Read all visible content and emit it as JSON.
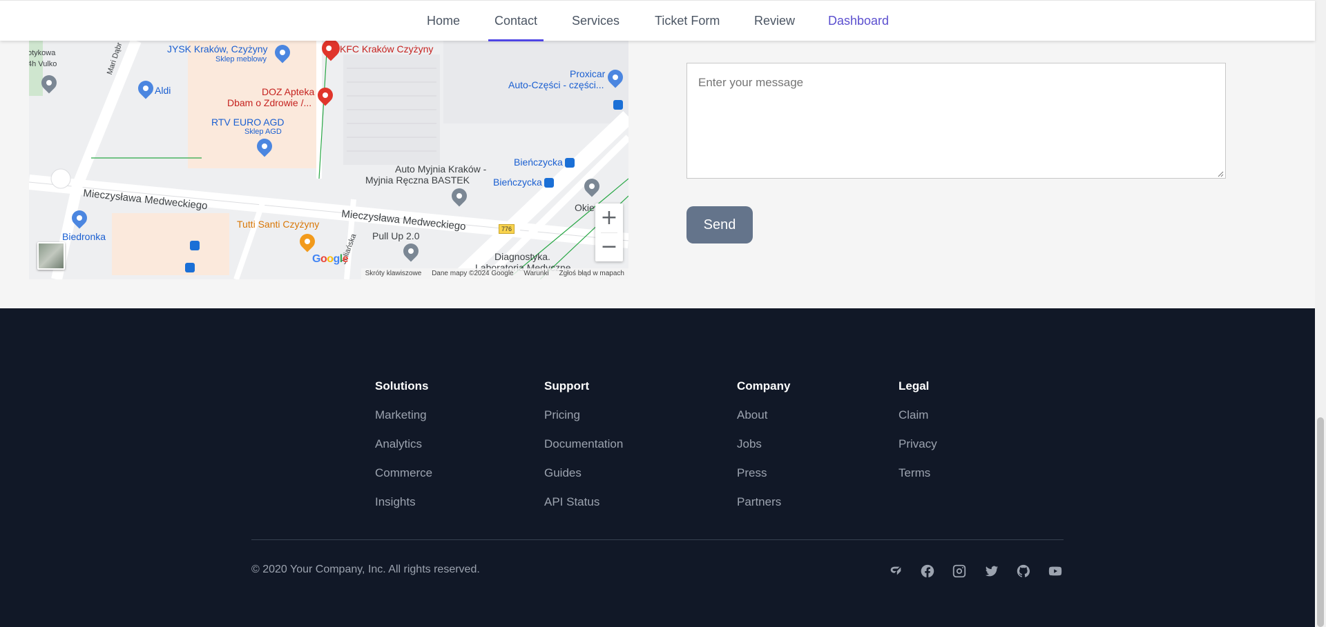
{
  "nav": {
    "items": [
      {
        "label": "Home"
      },
      {
        "label": "Contact"
      },
      {
        "label": "Services"
      },
      {
        "label": "Ticket Form"
      },
      {
        "label": "Review"
      },
      {
        "label": "Dashboard"
      }
    ],
    "active": "Contact"
  },
  "map": {
    "places": {
      "jysk": "JYSK Kraków, Czyżyny",
      "jysk_sub": "Sklep meblowy",
      "kfc": "KFC Kraków Czyżyny",
      "aldi": "Aldi",
      "doz_1": "DOZ Apteka",
      "doz_2": "Dbam o Zdrowie /...",
      "rtv_1": "RTV EURO AGD",
      "rtv_sub": "Sklep AGD",
      "proxicar_1": "Proxicar",
      "proxicar_2": "Auto-Części - części...",
      "bienczycka_1": "Bieńczycka",
      "bienczycka_2": "Bieńczycka",
      "myjnia_1": "Auto Myjnia Kraków -",
      "myjnia_2": "Myjnia Ręczna BASTEK",
      "biedronka": "Biedronka",
      "tutti": "Tutti Santi Czyżyny",
      "pullup": "Pull Up 2.0",
      "diag_1": "Diagnostyka.",
      "diag_2": "Laboratoria Medyczne",
      "okie": "Okie",
      "botykowa": "otykowa",
      "vulko": "4h Vulko",
      "mari": "Mari Dąbr",
      "juliana": "Juliańska"
    },
    "roads": {
      "medweckiego_1": "Mieczysława Medweckiego",
      "medweckiego_2": "Mieczysława Medweckiego",
      "route": "776"
    },
    "zoom_in": "+",
    "zoom_out": "−",
    "google_logo": "Google",
    "footer": {
      "shortcuts": "Skróty klawiszowe",
      "data": "Dane mapy ©2024 Google",
      "terms": "Warunki",
      "report": "Zgłoś błąd w mapach"
    }
  },
  "form": {
    "message_placeholder": "Enter your message",
    "send_label": "Send"
  },
  "footer": {
    "columns": [
      {
        "title": "Solutions",
        "links": [
          "Marketing",
          "Analytics",
          "Commerce",
          "Insights"
        ]
      },
      {
        "title": "Support",
        "links": [
          "Pricing",
          "Documentation",
          "Guides",
          "API Status"
        ]
      },
      {
        "title": "Company",
        "links": [
          "About",
          "Jobs",
          "Press",
          "Partners"
        ]
      },
      {
        "title": "Legal",
        "links": [
          "Claim",
          "Privacy",
          "Terms"
        ]
      }
    ],
    "copyright": "© 2020 Your Company, Inc. All rights reserved.",
    "social_icons": [
      "openai-like-icon",
      "facebook-icon",
      "instagram-icon",
      "twitter-icon",
      "github-icon",
      "youtube-icon"
    ]
  },
  "colors": {
    "accent": "#4f46e5",
    "footer_bg": "#111827",
    "button_bg": "#64748b"
  }
}
